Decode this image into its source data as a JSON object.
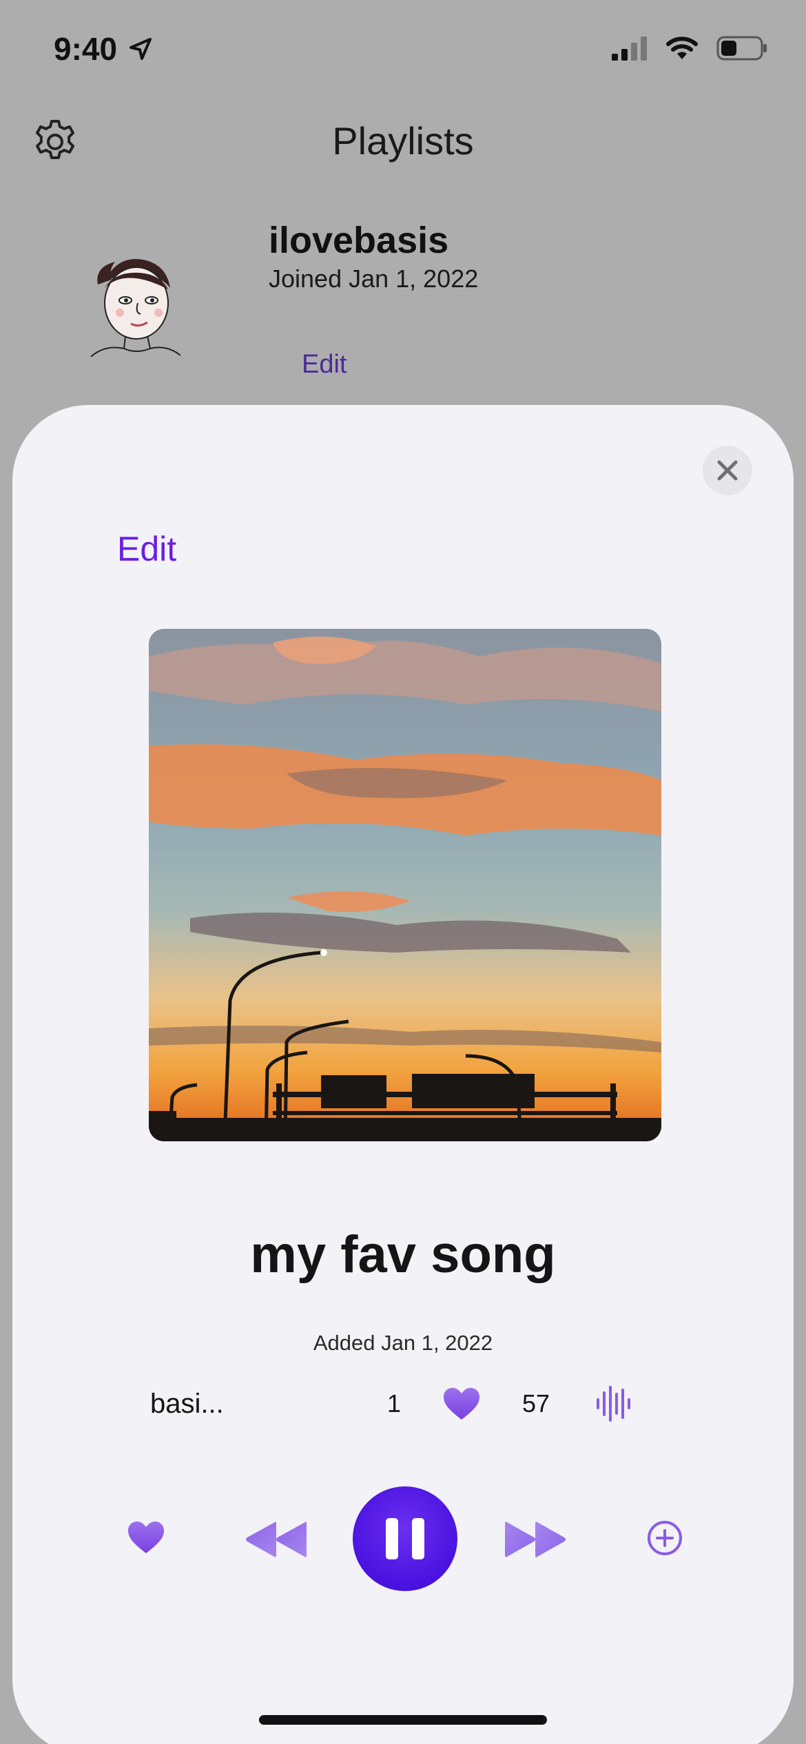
{
  "status_bar": {
    "time": "9:40"
  },
  "header": {
    "title": "Playlists"
  },
  "profile": {
    "username": "ilovebasis",
    "joined": "Joined Jan 1, 2022",
    "edit_label": "Edit"
  },
  "sheet": {
    "edit_label": "Edit",
    "song": {
      "title": "my fav song",
      "added": "Added Jan 1, 2022",
      "author": "basi...",
      "count_1": "1",
      "count_2": "57"
    }
  },
  "colors": {
    "accent": "#6a1ee0",
    "accent_light": "#8a5ae8",
    "sheet_bg": "#f2f2f7",
    "dimmed_bg": "#adadad"
  },
  "icons": {
    "settings": "gear-icon",
    "close": "close-icon",
    "heart": "heart-icon",
    "waveform": "waveform-icon",
    "rewind": "rewind-icon",
    "pause": "pause-icon",
    "fast_forward": "fast-forward-icon",
    "add": "add-circle-icon",
    "location": "location-arrow-icon",
    "signal": "cellular-signal-icon",
    "wifi": "wifi-icon",
    "battery": "battery-icon"
  }
}
